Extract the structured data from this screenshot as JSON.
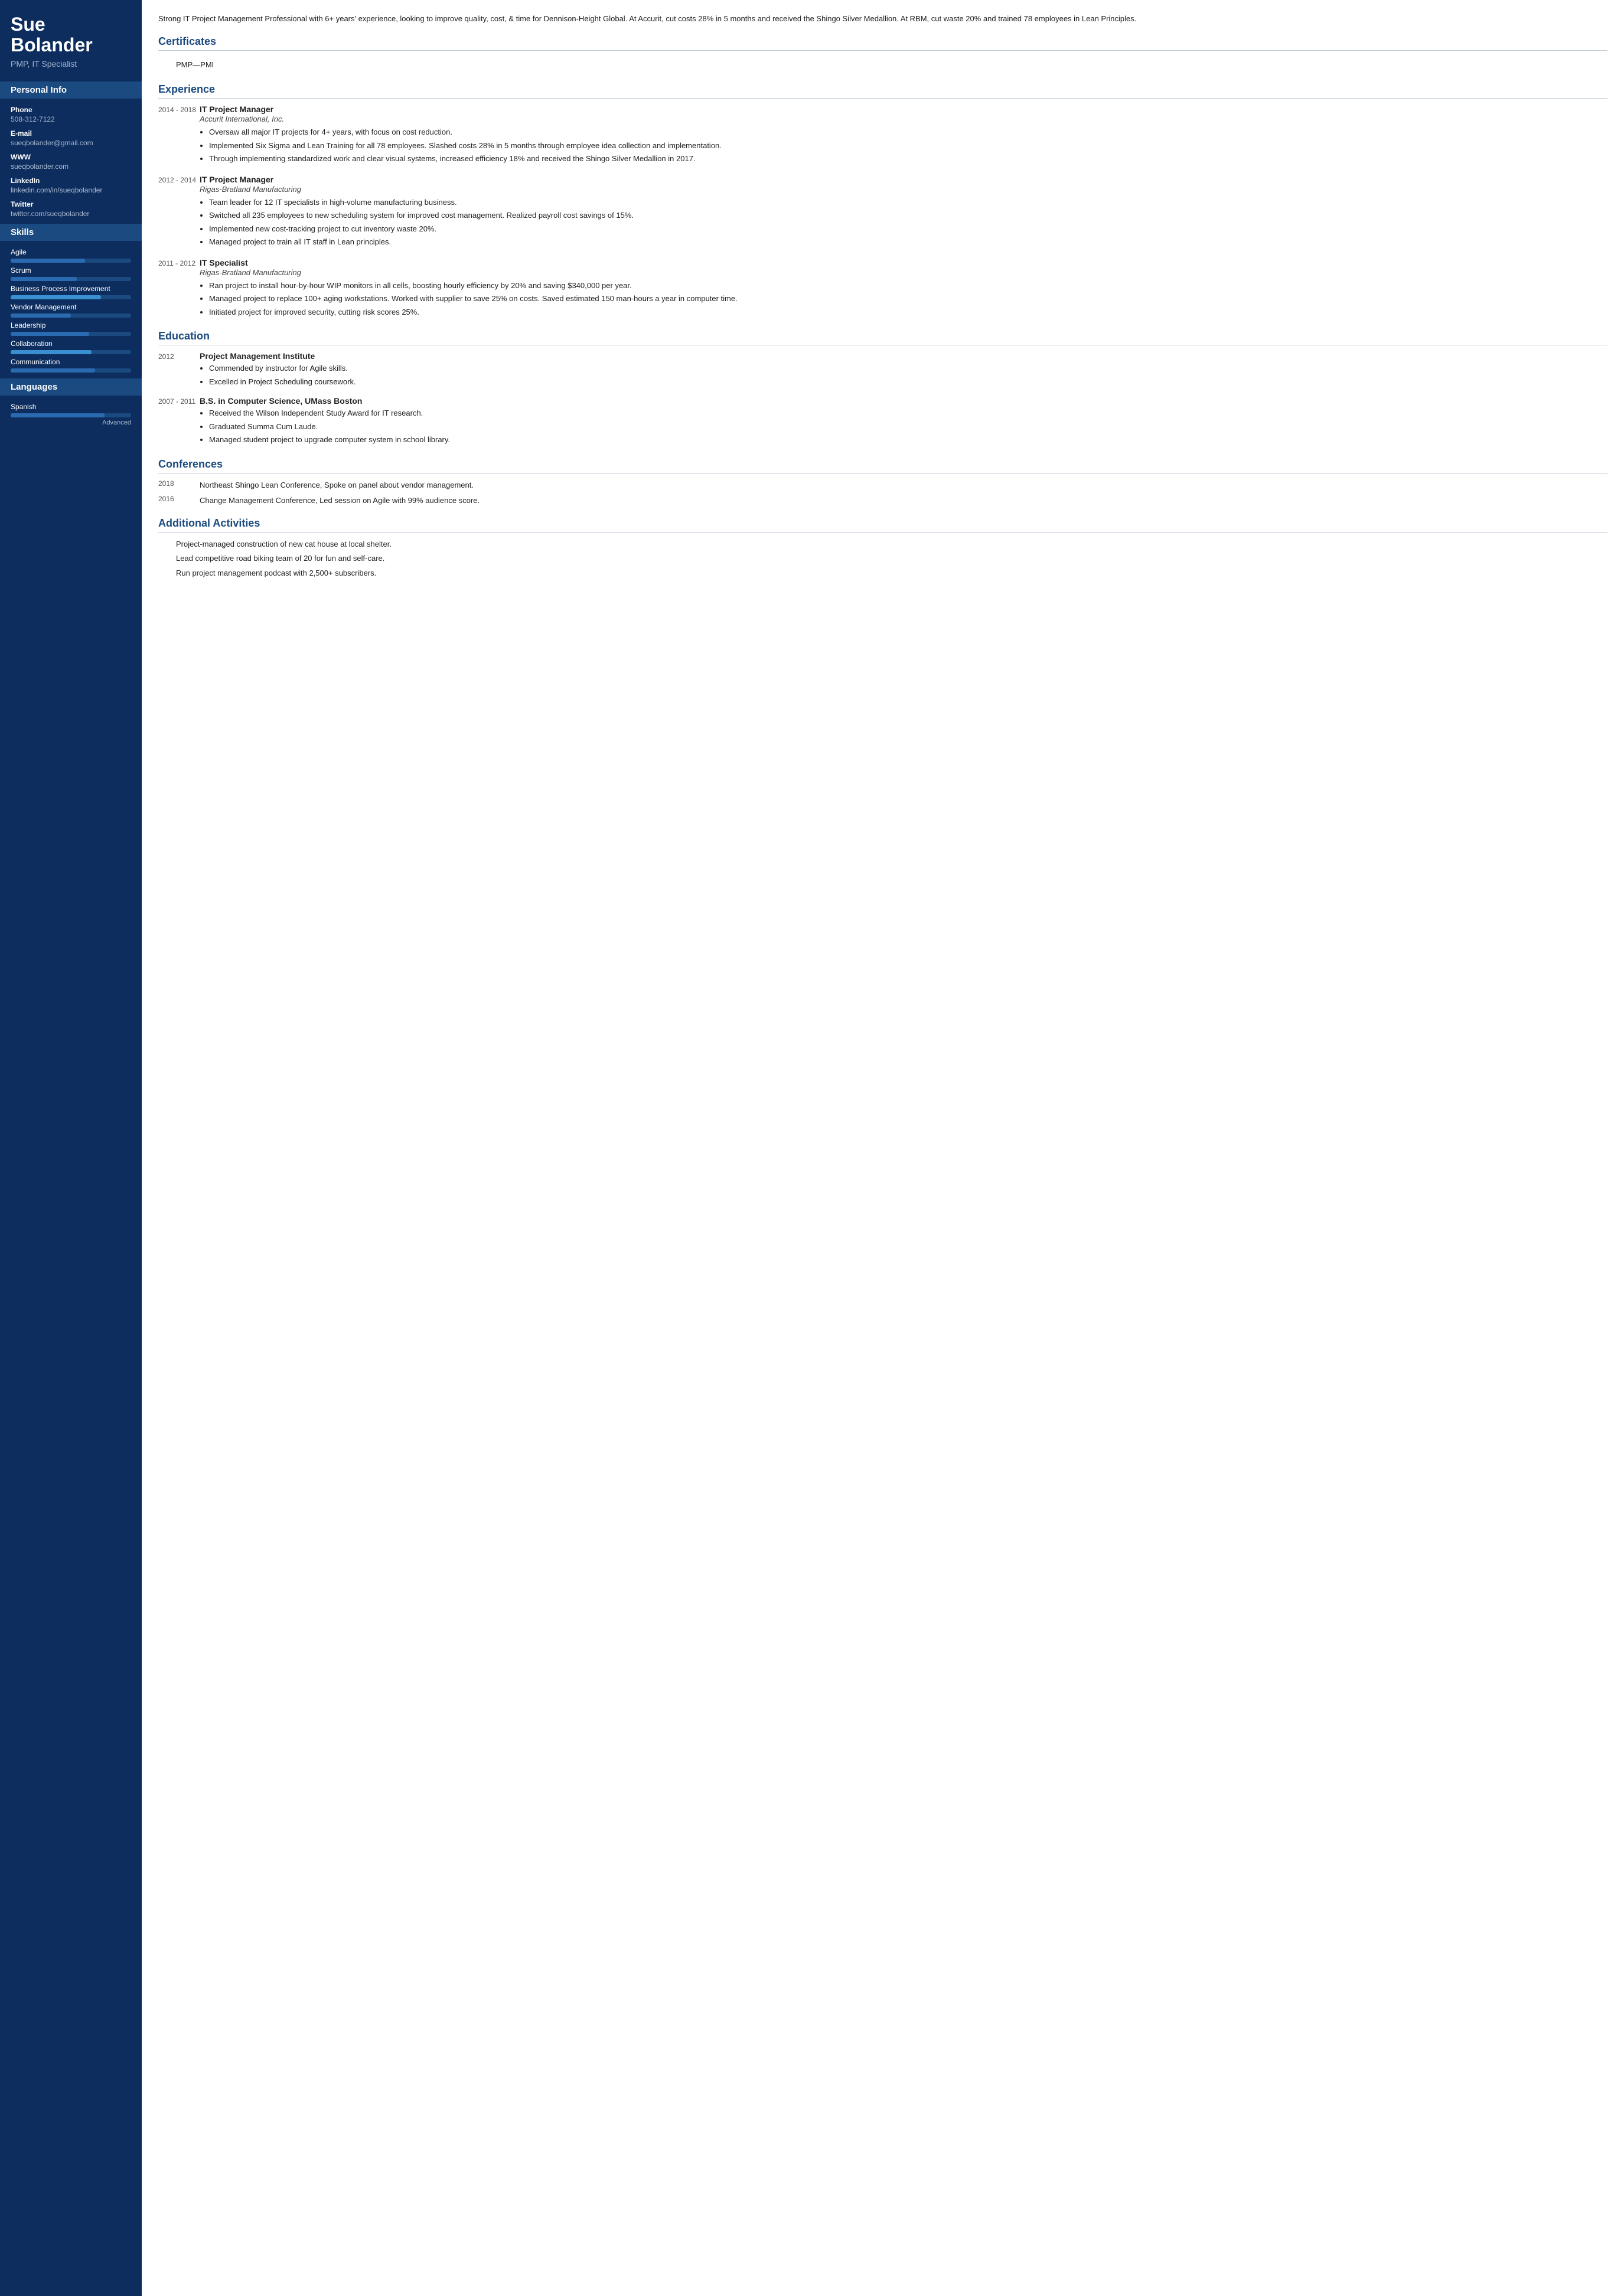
{
  "sidebar": {
    "name": "Sue Bolander",
    "title": "PMP, IT Specialist",
    "personal_info_label": "Personal Info",
    "phone_label": "Phone",
    "phone": "508-312-7122",
    "email_label": "E-mail",
    "email": "sueqbolander@gmail.com",
    "www_label": "WWW",
    "www": "sueqbolander.com",
    "linkedin_label": "LinkedIn",
    "linkedin": "linkedin.com/in/sueqbolander",
    "twitter_label": "Twitter",
    "twitter": "twitter.com/sueqbolander",
    "skills_label": "Skills",
    "skills": [
      {
        "name": "Agile",
        "fill": 62,
        "accent": false
      },
      {
        "name": "Scrum",
        "fill": 55,
        "accent": false
      },
      {
        "name": "Business Process Improvement",
        "fill": 75,
        "accent": true
      },
      {
        "name": "Vendor Management",
        "fill": 50,
        "accent": false
      },
      {
        "name": "Leadership",
        "fill": 65,
        "accent": false
      },
      {
        "name": "Collaboration",
        "fill": 67,
        "accent": true
      },
      {
        "name": "Communication",
        "fill": 70,
        "accent": false
      }
    ],
    "languages_label": "Languages",
    "languages": [
      {
        "name": "Spanish",
        "fill": 78,
        "level": "Advanced"
      }
    ]
  },
  "main": {
    "summary": "Strong IT Project Management Professional with 6+ years' experience, looking to improve quality, cost, & time for Dennison-Height Global. At Accurit, cut costs 28% in 5 months and received the Shingo Silver Medallion. At RBM, cut waste 20% and trained 78 employees in Lean Principles.",
    "certificates_label": "Certificates",
    "certificates": [
      {
        "name": "PMP—PMI"
      }
    ],
    "experience_label": "Experience",
    "experience": [
      {
        "date": "2014 - 2018",
        "title": "IT Project Manager",
        "company": "Accurit International, Inc.",
        "bullets": [
          "Oversaw all major IT projects for 4+ years, with focus on cost reduction.",
          "Implemented Six Sigma and Lean Training for all 78 employees. Slashed costs 28% in 5 months through employee idea collection and implementation.",
          "Through implementing standardized work and clear visual systems, increased efficiency 18% and received the Shingo Silver Medallion in 2017."
        ]
      },
      {
        "date": "2012 - 2014",
        "title": "IT Project Manager",
        "company": "Rigas-Bratland Manufacturing",
        "bullets": [
          "Team leader for 12 IT specialists in high-volume manufacturing business.",
          "Switched all 235 employees to new scheduling system for improved cost management. Realized payroll cost savings of 15%.",
          "Implemented new cost-tracking project to cut inventory waste 20%.",
          "Managed project to train all IT staff in Lean principles."
        ]
      },
      {
        "date": "2011 - 2012",
        "title": "IT Specialist",
        "company": "Rigas-Bratland Manufacturing",
        "bullets": [
          "Ran project to install hour-by-hour WIP monitors in all cells, boosting hourly efficiency by 20% and saving $340,000 per year.",
          "Managed project to replace 100+ aging workstations. Worked with supplier to save 25% on costs. Saved estimated 150 man-hours a year in computer time.",
          "Initiated project for improved security, cutting risk scores 25%."
        ]
      }
    ],
    "education_label": "Education",
    "education": [
      {
        "date": "2012",
        "title": "Project Management Institute",
        "bullets": [
          "Commended by instructor for Agile skills.",
          "Excelled in Project Scheduling coursework."
        ]
      },
      {
        "date": "2007 - 2011",
        "title": "B.S. in Computer Science, UMass Boston",
        "bullets": [
          "Received the Wilson Independent Study Award for IT research.",
          "Graduated Summa Cum Laude.",
          "Managed student project to upgrade computer system in school library."
        ]
      }
    ],
    "conferences_label": "Conferences",
    "conferences": [
      {
        "date": "2018",
        "text": "Northeast Shingo Lean Conference, Spoke on panel about vendor management."
      },
      {
        "date": "2016",
        "text": "Change Management Conference, Led session on Agile with 99% audience score."
      }
    ],
    "activities_label": "Additional Activities",
    "activities": [
      "Project-managed construction of new cat house at local shelter.",
      "Lead competitive road biking team of 20 for fun and self-care.",
      "Run project management podcast with 2,500+ subscribers."
    ]
  }
}
